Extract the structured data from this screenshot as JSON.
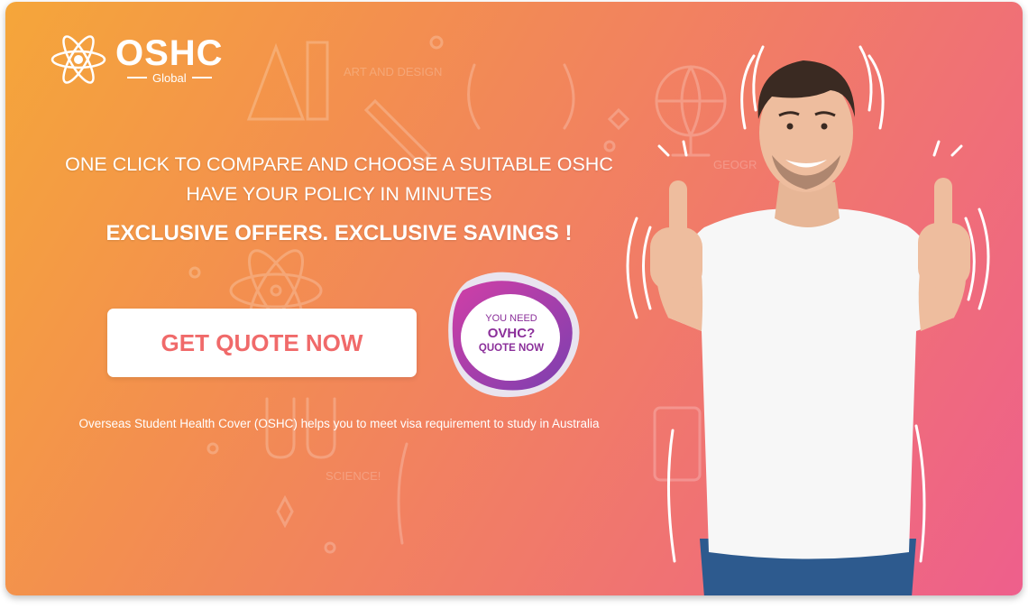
{
  "brand": {
    "name": "OSHC",
    "sub": "Global"
  },
  "hero": {
    "line1": "ONE CLICK TO COMPARE AND CHOOSE A SUITABLE OSHC",
    "line2": "HAVE YOUR POLICY IN MINUTES",
    "line3": "EXCLUSIVE OFFERS. EXCLUSIVE SAVINGS !"
  },
  "cta": {
    "label": "GET QUOTE NOW"
  },
  "badge": {
    "line1": "YOU NEED",
    "line2": "OVHC?",
    "line3": "QUOTE NOW"
  },
  "footnote": "Overseas Student Health Cover (OSHC) helps you to meet visa requirement to study in Australia",
  "doodles": {
    "art_label": "ART AND DESIGN",
    "science_label": "SCIENCE!",
    "geo_label": "GEOGR"
  },
  "colors": {
    "gradient_start": "#f5a63a",
    "gradient_end": "#ee5f8c",
    "cta_text": "#f06a6a",
    "badge_text": "#8b2f9a"
  },
  "icons": [
    "atom-logo-icon",
    "thumbs-up-person-illustration"
  ]
}
